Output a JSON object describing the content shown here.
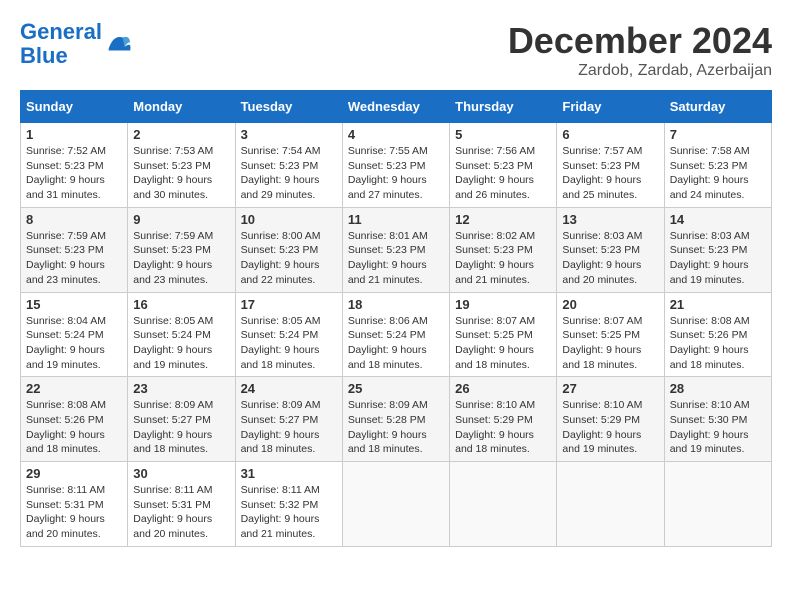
{
  "logo": {
    "line1": "General",
    "line2": "Blue"
  },
  "title": "December 2024",
  "location": "Zardob, Zardab, Azerbaijan",
  "days_of_week": [
    "Sunday",
    "Monday",
    "Tuesday",
    "Wednesday",
    "Thursday",
    "Friday",
    "Saturday"
  ],
  "weeks": [
    [
      {
        "day": "1",
        "sunrise": "7:52 AM",
        "sunset": "5:23 PM",
        "daylight": "9 hours and 31 minutes."
      },
      {
        "day": "2",
        "sunrise": "7:53 AM",
        "sunset": "5:23 PM",
        "daylight": "9 hours and 30 minutes."
      },
      {
        "day": "3",
        "sunrise": "7:54 AM",
        "sunset": "5:23 PM",
        "daylight": "9 hours and 29 minutes."
      },
      {
        "day": "4",
        "sunrise": "7:55 AM",
        "sunset": "5:23 PM",
        "daylight": "9 hours and 27 minutes."
      },
      {
        "day": "5",
        "sunrise": "7:56 AM",
        "sunset": "5:23 PM",
        "daylight": "9 hours and 26 minutes."
      },
      {
        "day": "6",
        "sunrise": "7:57 AM",
        "sunset": "5:23 PM",
        "daylight": "9 hours and 25 minutes."
      },
      {
        "day": "7",
        "sunrise": "7:58 AM",
        "sunset": "5:23 PM",
        "daylight": "9 hours and 24 minutes."
      }
    ],
    [
      {
        "day": "8",
        "sunrise": "7:59 AM",
        "sunset": "5:23 PM",
        "daylight": "9 hours and 23 minutes."
      },
      {
        "day": "9",
        "sunrise": "7:59 AM",
        "sunset": "5:23 PM",
        "daylight": "9 hours and 23 minutes."
      },
      {
        "day": "10",
        "sunrise": "8:00 AM",
        "sunset": "5:23 PM",
        "daylight": "9 hours and 22 minutes."
      },
      {
        "day": "11",
        "sunrise": "8:01 AM",
        "sunset": "5:23 PM",
        "daylight": "9 hours and 21 minutes."
      },
      {
        "day": "12",
        "sunrise": "8:02 AM",
        "sunset": "5:23 PM",
        "daylight": "9 hours and 21 minutes."
      },
      {
        "day": "13",
        "sunrise": "8:03 AM",
        "sunset": "5:23 PM",
        "daylight": "9 hours and 20 minutes."
      },
      {
        "day": "14",
        "sunrise": "8:03 AM",
        "sunset": "5:23 PM",
        "daylight": "9 hours and 19 minutes."
      }
    ],
    [
      {
        "day": "15",
        "sunrise": "8:04 AM",
        "sunset": "5:24 PM",
        "daylight": "9 hours and 19 minutes."
      },
      {
        "day": "16",
        "sunrise": "8:05 AM",
        "sunset": "5:24 PM",
        "daylight": "9 hours and 19 minutes."
      },
      {
        "day": "17",
        "sunrise": "8:05 AM",
        "sunset": "5:24 PM",
        "daylight": "9 hours and 18 minutes."
      },
      {
        "day": "18",
        "sunrise": "8:06 AM",
        "sunset": "5:24 PM",
        "daylight": "9 hours and 18 minutes."
      },
      {
        "day": "19",
        "sunrise": "8:07 AM",
        "sunset": "5:25 PM",
        "daylight": "9 hours and 18 minutes."
      },
      {
        "day": "20",
        "sunrise": "8:07 AM",
        "sunset": "5:25 PM",
        "daylight": "9 hours and 18 minutes."
      },
      {
        "day": "21",
        "sunrise": "8:08 AM",
        "sunset": "5:26 PM",
        "daylight": "9 hours and 18 minutes."
      }
    ],
    [
      {
        "day": "22",
        "sunrise": "8:08 AM",
        "sunset": "5:26 PM",
        "daylight": "9 hours and 18 minutes."
      },
      {
        "day": "23",
        "sunrise": "8:09 AM",
        "sunset": "5:27 PM",
        "daylight": "9 hours and 18 minutes."
      },
      {
        "day": "24",
        "sunrise": "8:09 AM",
        "sunset": "5:27 PM",
        "daylight": "9 hours and 18 minutes."
      },
      {
        "day": "25",
        "sunrise": "8:09 AM",
        "sunset": "5:28 PM",
        "daylight": "9 hours and 18 minutes."
      },
      {
        "day": "26",
        "sunrise": "8:10 AM",
        "sunset": "5:29 PM",
        "daylight": "9 hours and 18 minutes."
      },
      {
        "day": "27",
        "sunrise": "8:10 AM",
        "sunset": "5:29 PM",
        "daylight": "9 hours and 19 minutes."
      },
      {
        "day": "28",
        "sunrise": "8:10 AM",
        "sunset": "5:30 PM",
        "daylight": "9 hours and 19 minutes."
      }
    ],
    [
      {
        "day": "29",
        "sunrise": "8:11 AM",
        "sunset": "5:31 PM",
        "daylight": "9 hours and 20 minutes."
      },
      {
        "day": "30",
        "sunrise": "8:11 AM",
        "sunset": "5:31 PM",
        "daylight": "9 hours and 20 minutes."
      },
      {
        "day": "31",
        "sunrise": "8:11 AM",
        "sunset": "5:32 PM",
        "daylight": "9 hours and 21 minutes."
      },
      null,
      null,
      null,
      null
    ]
  ],
  "labels": {
    "sunrise": "Sunrise:",
    "sunset": "Sunset:",
    "daylight": "Daylight:"
  }
}
